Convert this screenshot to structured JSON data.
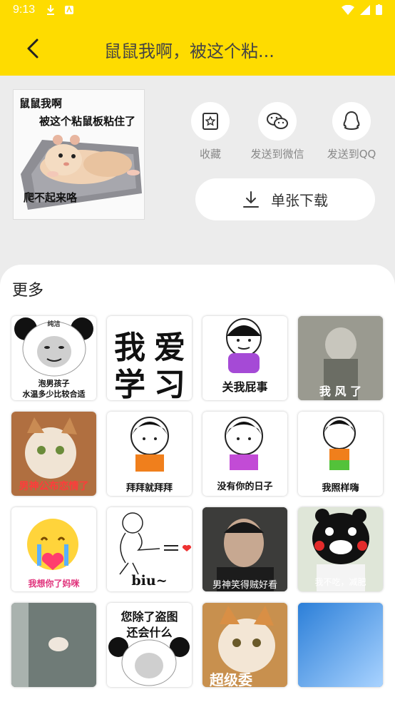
{
  "status": {
    "time": "9:13"
  },
  "header": {
    "title": "鼠鼠我啊，被这个粘..."
  },
  "preview": {
    "line1": "鼠鼠我啊",
    "line2": "被这个粘鼠板粘住了",
    "line3": "爬不起来咯"
  },
  "actions": {
    "favorite": "收藏",
    "wechat": "发送到微信",
    "qq": "发送到QQ",
    "download": "单张下载"
  },
  "more": {
    "title": "更多"
  },
  "grid": [
    {
      "top": "纯洁",
      "caption1": "泡男孩子",
      "caption2": "水温多少比较合适"
    },
    {
      "w1": "我",
      "w2": "爱",
      "w3": "学",
      "w4": "习"
    },
    {
      "caption": "关我屁事"
    },
    {
      "caption": "我 风 了"
    },
    {
      "caption": "男神公布恋情了"
    },
    {
      "caption": "拜拜就拜拜"
    },
    {
      "caption": "没有你的日子"
    },
    {
      "caption": "我照样嗨"
    },
    {
      "caption": "我想你了妈咪"
    },
    {
      "caption": "biu~"
    },
    {
      "caption": "男神笑得贼好看"
    },
    {
      "caption": "我不吃，减肥"
    },
    {
      "caption": ""
    },
    {
      "caption1": "您除了盗图",
      "caption2": "还会什么"
    },
    {
      "caption": "超级委"
    },
    {
      "caption": ""
    }
  ],
  "colors": {
    "accent": "#fedc00"
  }
}
